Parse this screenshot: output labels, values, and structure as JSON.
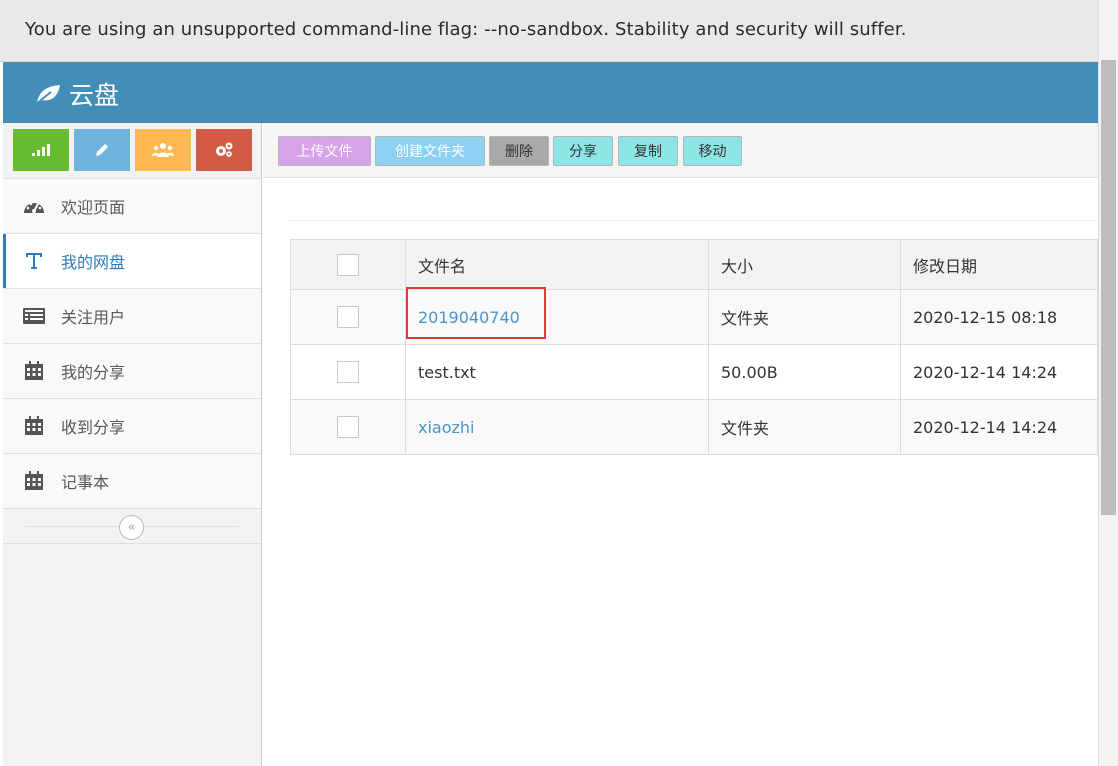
{
  "infobar": {
    "message": "You are using an unsupported command-line flag: --no-sandbox. Stability and security will suffer."
  },
  "navbar": {
    "brand": "云盘",
    "brand_icon": "leaf-icon"
  },
  "colors": {
    "navbar": "#438eb9",
    "accent_link": "#4a94c8",
    "highlight": "#e53a3a"
  },
  "shortcuts": [
    {
      "icon": "signal-icon",
      "color": "#68bc31"
    },
    {
      "icon": "pencil-icon",
      "color": "#6fb3e0"
    },
    {
      "icon": "users-icon",
      "color": "#ffb752"
    },
    {
      "icon": "cogs-icon",
      "color": "#d15b47"
    }
  ],
  "sidebar": {
    "items": [
      {
        "label": "欢迎页面",
        "icon": "dashboard-icon",
        "active": false
      },
      {
        "label": "我的网盘",
        "icon": "text-icon",
        "active": true
      },
      {
        "label": "关注用户",
        "icon": "list-icon",
        "active": false
      },
      {
        "label": "我的分享",
        "icon": "calendar-icon",
        "active": false
      },
      {
        "label": "收到分享",
        "icon": "calendar-icon",
        "active": false
      },
      {
        "label": "记事本",
        "icon": "calendar-icon",
        "active": false
      }
    ],
    "collapse_glyph": "«"
  },
  "toolbar": {
    "upload": "上传文件",
    "mkdir": "创建文件夹",
    "delete": "删除",
    "share": "分享",
    "copy": "复制",
    "move": "移动"
  },
  "table": {
    "headers": {
      "name": "文件名",
      "size": "大小",
      "date": "修改日期"
    },
    "rows": [
      {
        "name": "2019040740",
        "size": "文件夹",
        "date": "2020-12-15 08:18",
        "is_folder": true,
        "highlighted": true
      },
      {
        "name": "test.txt",
        "size": "50.00B",
        "date": "2020-12-14 14:24",
        "is_folder": false,
        "highlighted": false
      },
      {
        "name": "xiaozhi",
        "size": "文件夹",
        "date": "2020-12-14 14:24",
        "is_folder": true,
        "highlighted": false
      }
    ]
  }
}
